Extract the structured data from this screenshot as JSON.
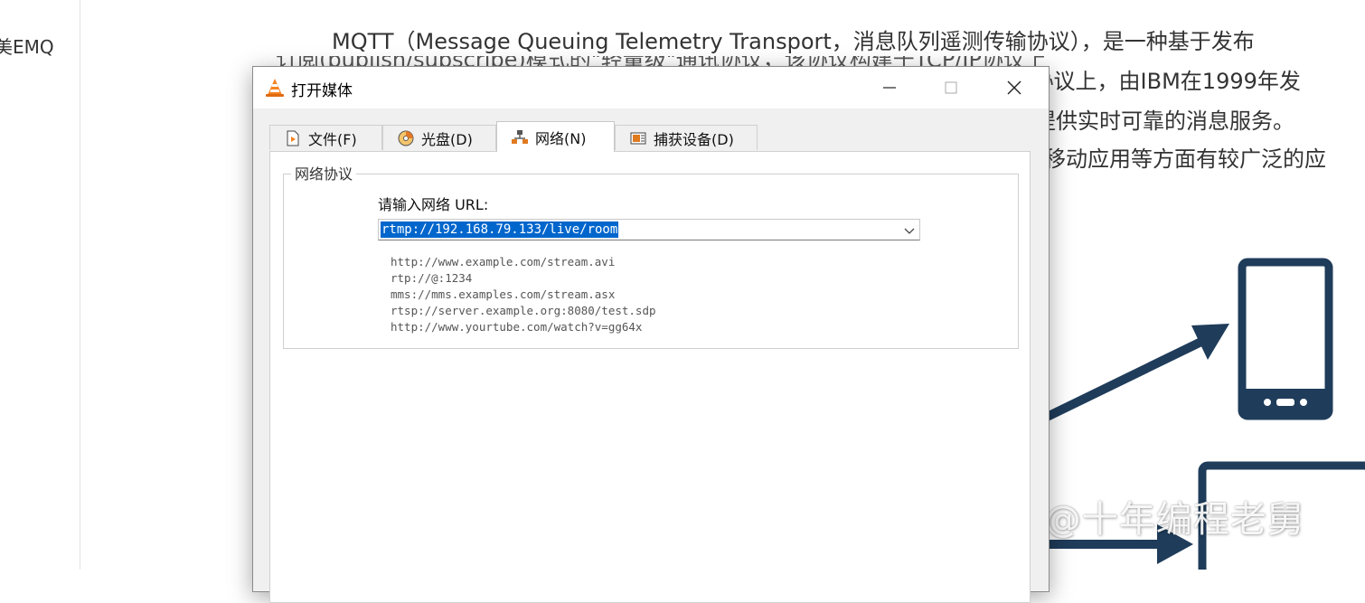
{
  "background": {
    "sidebar_item": "美EMQ",
    "para_line1": "MQTT（Message Queuing Telemetry  Transport，消息队列遥测传输协议），是一种基于发布",
    "para_line2": "IP协议上，由IBM在1999年发",
    "para_line3": "务提供实时可靠的消息服务。",
    "para_line4": "移动应用等方面有较广泛的应",
    "partial_line": "订阅(publish/subscribe)模式的\"轻量级\"通讯协议，该协议构建于TCP/IP协议上",
    "watermark": "知乎 @十年编程老舅",
    "illustration_color": "#1f3c5a"
  },
  "dialog": {
    "title": "打开媒体",
    "app_icon": "vlc-cone-icon",
    "tabs": [
      {
        "label": "文件(F)",
        "icon": "file-play-icon"
      },
      {
        "label": "光盘(D)",
        "icon": "disc-icon"
      },
      {
        "label": "网络(N)",
        "icon": "network-icon",
        "active": true
      },
      {
        "label": "捕获设备(D)",
        "icon": "capture-device-icon"
      }
    ],
    "group_title": "网络协议",
    "url_label": "请输入网络 URL:",
    "url_value": "rtmp://192.168.79.133/live/room",
    "examples": [
      "http://www.example.com/stream.avi",
      "rtp://@:1234",
      "mms://mms.examples.com/stream.asx",
      "rtsp://server.example.org:8080/test.sdp",
      "http://www.yourtube.com/watch?v=gg64x"
    ]
  }
}
